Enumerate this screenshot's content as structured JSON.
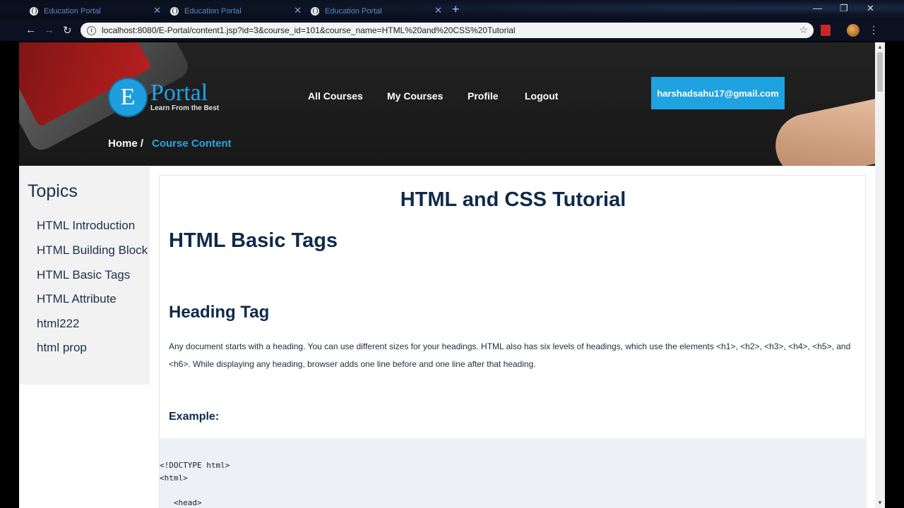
{
  "browser": {
    "tabs": [
      {
        "title": "Education Portal",
        "close": "✕"
      },
      {
        "title": "Education Portal",
        "close": "✕"
      },
      {
        "title": "Education Portal",
        "close": "✕"
      }
    ],
    "new_tab": "+",
    "window_controls": {
      "minimize": "—",
      "restore": "❐",
      "close": "✕"
    },
    "nav": {
      "back": "←",
      "forward": "→",
      "reload": "↻"
    },
    "url": "localhost:8080/E-Portal/content1.jsp?id=3&course_id=101&course_name=HTML%20and%20CSS%20Tutorial",
    "bookmark_star": "☆",
    "menu": "⋮"
  },
  "header": {
    "logo_letter": "E",
    "logo_brand": "Portal",
    "logo_tagline": "Learn From the Best",
    "nav_items": [
      "All Courses",
      "My Courses",
      "Profile",
      "Logout"
    ],
    "user_email": "harshadsahu17@gmail.com",
    "breadcrumb_home": "Home /",
    "breadcrumb_current": "Course Content"
  },
  "sidebar": {
    "title": "Topics",
    "items": [
      "HTML Introduction",
      "HTML Building Block",
      "HTML Basic Tags",
      "HTML Attribute",
      "html222",
      "html prop"
    ]
  },
  "content": {
    "course_title": "HTML and CSS Tutorial",
    "topic_title": "HTML Basic Tags",
    "section_title": "Heading Tag",
    "paragraph": "Any document starts with a heading. You can use different sizes for your headings. HTML also has six levels of headings, which use the elements <h1>, <h2>, <h3>, <h4>, <h5>, and <h6>. While displaying any heading, browser adds one line before and one line after that heading.",
    "example_label": "Example:",
    "code": "<!DOCTYPE html>\n<html>\n\n   <head>"
  },
  "colors": {
    "accent": "#1fa2e0",
    "heading": "#0f2a4a",
    "sidebar_bg": "#f2f2f2",
    "code_bg": "#edf1f5"
  }
}
